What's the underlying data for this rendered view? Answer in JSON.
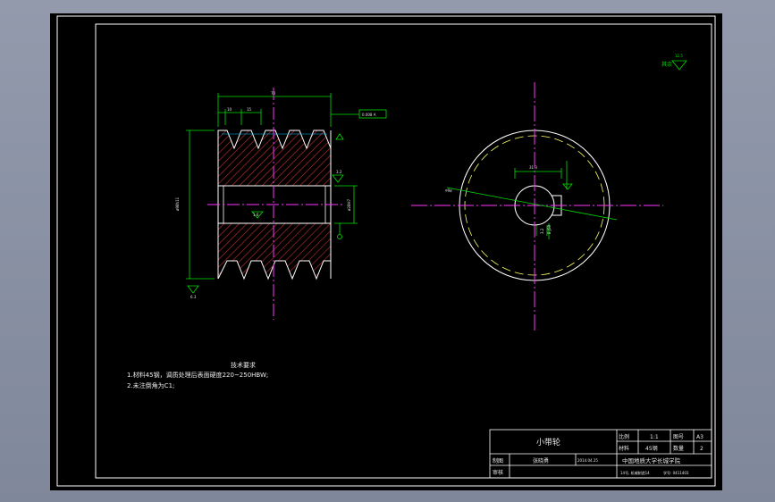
{
  "drawing": {
    "part_title": "小带轮",
    "tech_req": {
      "heading": "技术要求",
      "items": [
        "1.材料45钢，调质处理后表面硬度220~250HBW;",
        "2.未注倒角为C1;"
      ]
    },
    "roughness_note": "其余",
    "title_block": {
      "ratio_label": "比例",
      "ratio_value": "1:1",
      "sheet_label": "图号",
      "sheet_value": "A3",
      "material_label": "材料",
      "material_value": "45钢",
      "qty_label": "数量",
      "qty_value": "2",
      "drawn_label": "制图",
      "drawn_name": "张晓勇",
      "drawn_date": "2014.04.25",
      "checked_label": "审核",
      "school": "中国地质大学长城学院",
      "footer_left": "14号, 机械制造14",
      "footer_right": "学号: 0411403"
    }
  },
  "colors": {
    "outline": "#ffffff",
    "dimension": "#00e000",
    "centerline": "#ff33ff",
    "hatch": "#d03030",
    "hidden": "#ffff66"
  }
}
